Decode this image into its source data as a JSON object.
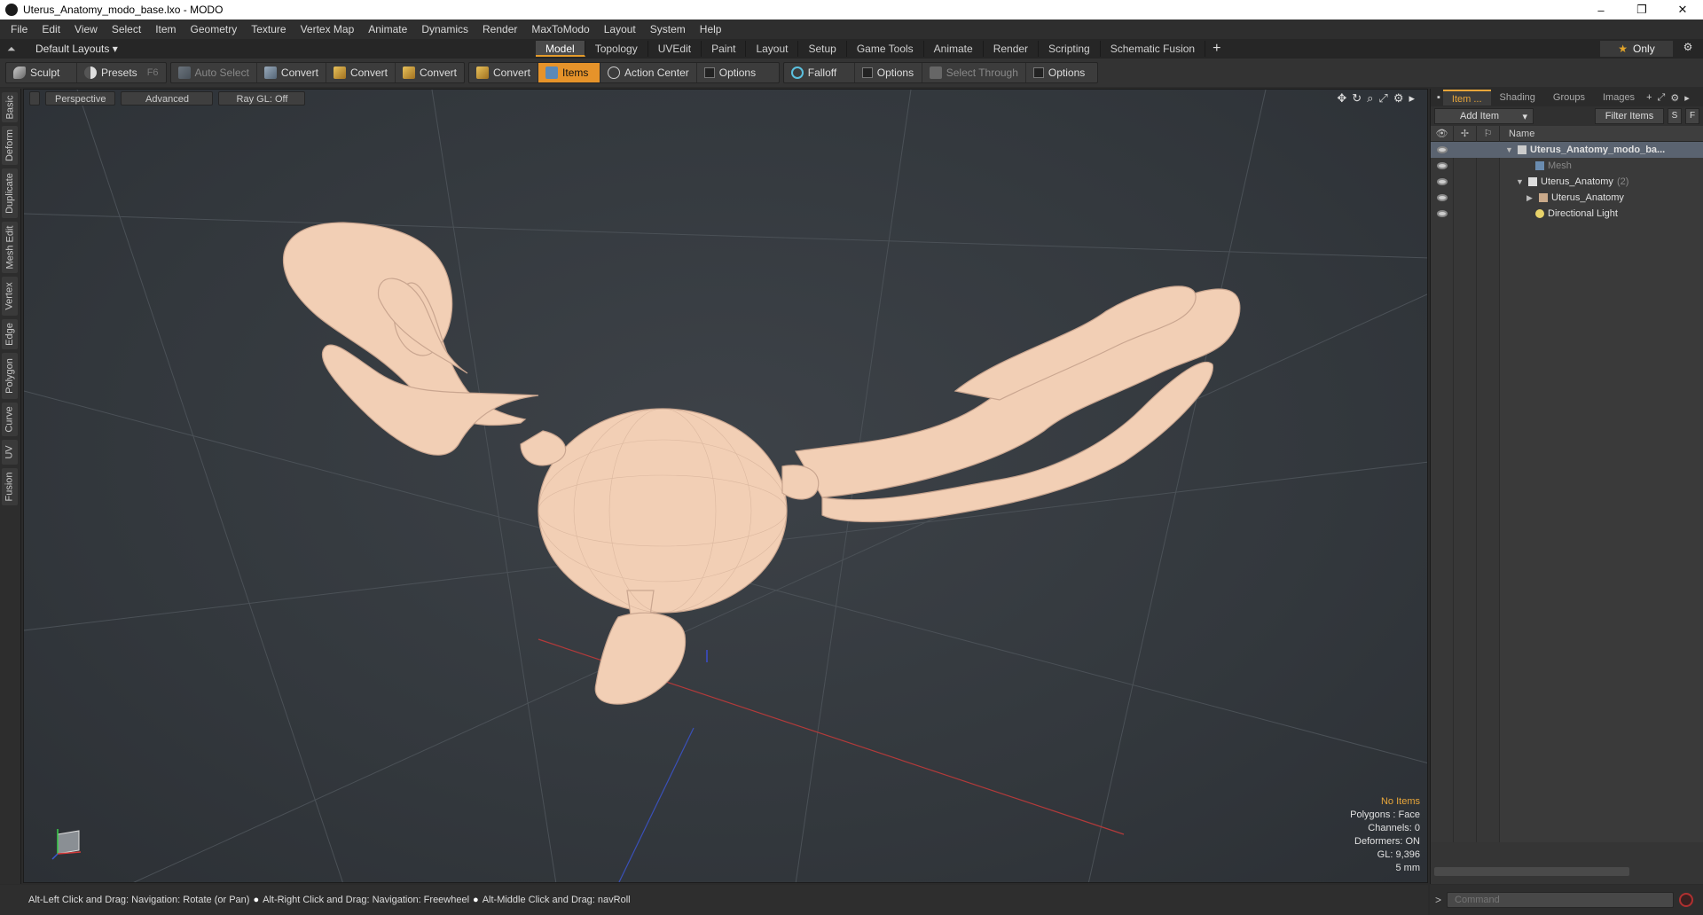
{
  "window": {
    "title": "Uterus_Anatomy_modo_base.lxo - MODO",
    "controls": [
      "–",
      "❐",
      "✕"
    ]
  },
  "menu": [
    "File",
    "Edit",
    "View",
    "Select",
    "Item",
    "Geometry",
    "Texture",
    "Vertex Map",
    "Animate",
    "Dynamics",
    "Render",
    "MaxToModo",
    "Layout",
    "System",
    "Help"
  ],
  "layout_selector": "Default Layouts ▾",
  "layout_tabs": [
    {
      "label": "Model",
      "active": true
    },
    {
      "label": "Topology",
      "active": false
    },
    {
      "label": "UVEdit",
      "active": false
    },
    {
      "label": "Paint",
      "active": false
    },
    {
      "label": "Layout",
      "active": false
    },
    {
      "label": "Setup",
      "active": false
    },
    {
      "label": "Game Tools",
      "active": false
    },
    {
      "label": "Animate",
      "active": false
    },
    {
      "label": "Render",
      "active": false
    },
    {
      "label": "Scripting",
      "active": false
    },
    {
      "label": "Schematic Fusion",
      "active": false
    }
  ],
  "only_button": "Only",
  "toolbar": {
    "sculpt": "Sculpt",
    "presets": "Presets",
    "presets_key": "F6",
    "auto_select": "Auto Select",
    "convert1": "Convert",
    "convert2": "Convert",
    "convert3": "Convert",
    "convert4": "Convert",
    "items": "Items",
    "action_center": "Action Center",
    "options1": "Options",
    "falloff": "Falloff",
    "options2": "Options",
    "select_through": "Select Through",
    "options3": "Options"
  },
  "left_tabs": [
    "Basic",
    "Deform",
    "Duplicate",
    "Mesh Edit",
    "Vertex",
    "Edge",
    "Polygon",
    "Curve",
    "UV",
    "Fusion"
  ],
  "viewport": {
    "projection": "Perspective",
    "shading": "Advanced",
    "raygl": "Ray GL: Off",
    "info": {
      "selection": "No Items",
      "polygons": "Polygons : Face",
      "channels": "Channels: 0",
      "deformers": "Deformers: ON",
      "gl": "GL: 9,396",
      "scale": "5 mm"
    },
    "mesh_color": "#f2cfb5"
  },
  "right_panel": {
    "tabs": [
      "Item ...",
      "Shading",
      "Groups",
      "Images"
    ],
    "add_item": "Add Item",
    "filter_items": "Filter Items",
    "s_btn": "S",
    "f_btn": "F",
    "name_header": "Name",
    "tree": [
      {
        "label": "Uterus_Anatomy_modo_ba...",
        "depth": 0,
        "bold": true,
        "selected": true,
        "icon": "scene-icon"
      },
      {
        "label": "Mesh",
        "depth": 1,
        "dim": true,
        "icon": "mesh-icon"
      },
      {
        "label": "Uterus_Anatomy",
        "count": "(2)",
        "depth": 1,
        "icon": "group-icon"
      },
      {
        "label": "Uterus_Anatomy",
        "depth": 2,
        "icon": "locator-icon"
      },
      {
        "label": "Directional Light",
        "depth": 1,
        "icon": "light-icon"
      }
    ]
  },
  "status": {
    "hint1": "Alt-Left Click and Drag: Navigation: Rotate (or Pan)",
    "hint2": "Alt-Right Click and Drag: Navigation: Freewheel",
    "hint3": "Alt-Middle Click and Drag: navRoll"
  },
  "command": {
    "prompt": ">",
    "placeholder": "Command"
  }
}
